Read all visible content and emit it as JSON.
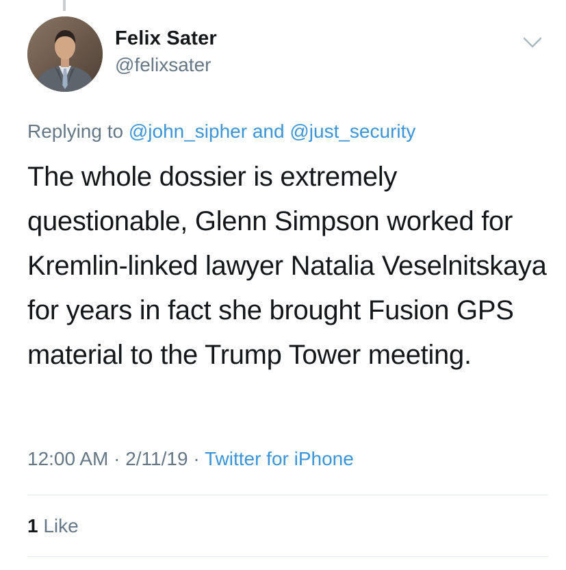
{
  "tweet": {
    "author_name": "Felix Sater",
    "author_handle": "@felixsater",
    "replying_prefix": "Replying to",
    "reply_mention_1": "@john_sipher",
    "reply_conjunction": "and",
    "reply_mention_2": "@just_security",
    "text": "The whole dossier is extremely questionable, Glenn Simpson worked for Kremlin-linked lawyer Natalia Veselnitskaya for years in fact she brought Fusion GPS material to the Trump Tower meeting.",
    "time": "12:00 AM",
    "date": "2/11/19",
    "separator": "·",
    "source": "Twitter for iPhone"
  },
  "stats": {
    "likes_count": "1",
    "likes_label": "Like"
  },
  "icons": {
    "menu": "chevron-down-icon",
    "avatar": "avatar-photo"
  },
  "colors": {
    "link": "#3b94d9",
    "secondary_text": "#657786",
    "primary_text": "#14171a",
    "divider": "#e1e8ed"
  }
}
